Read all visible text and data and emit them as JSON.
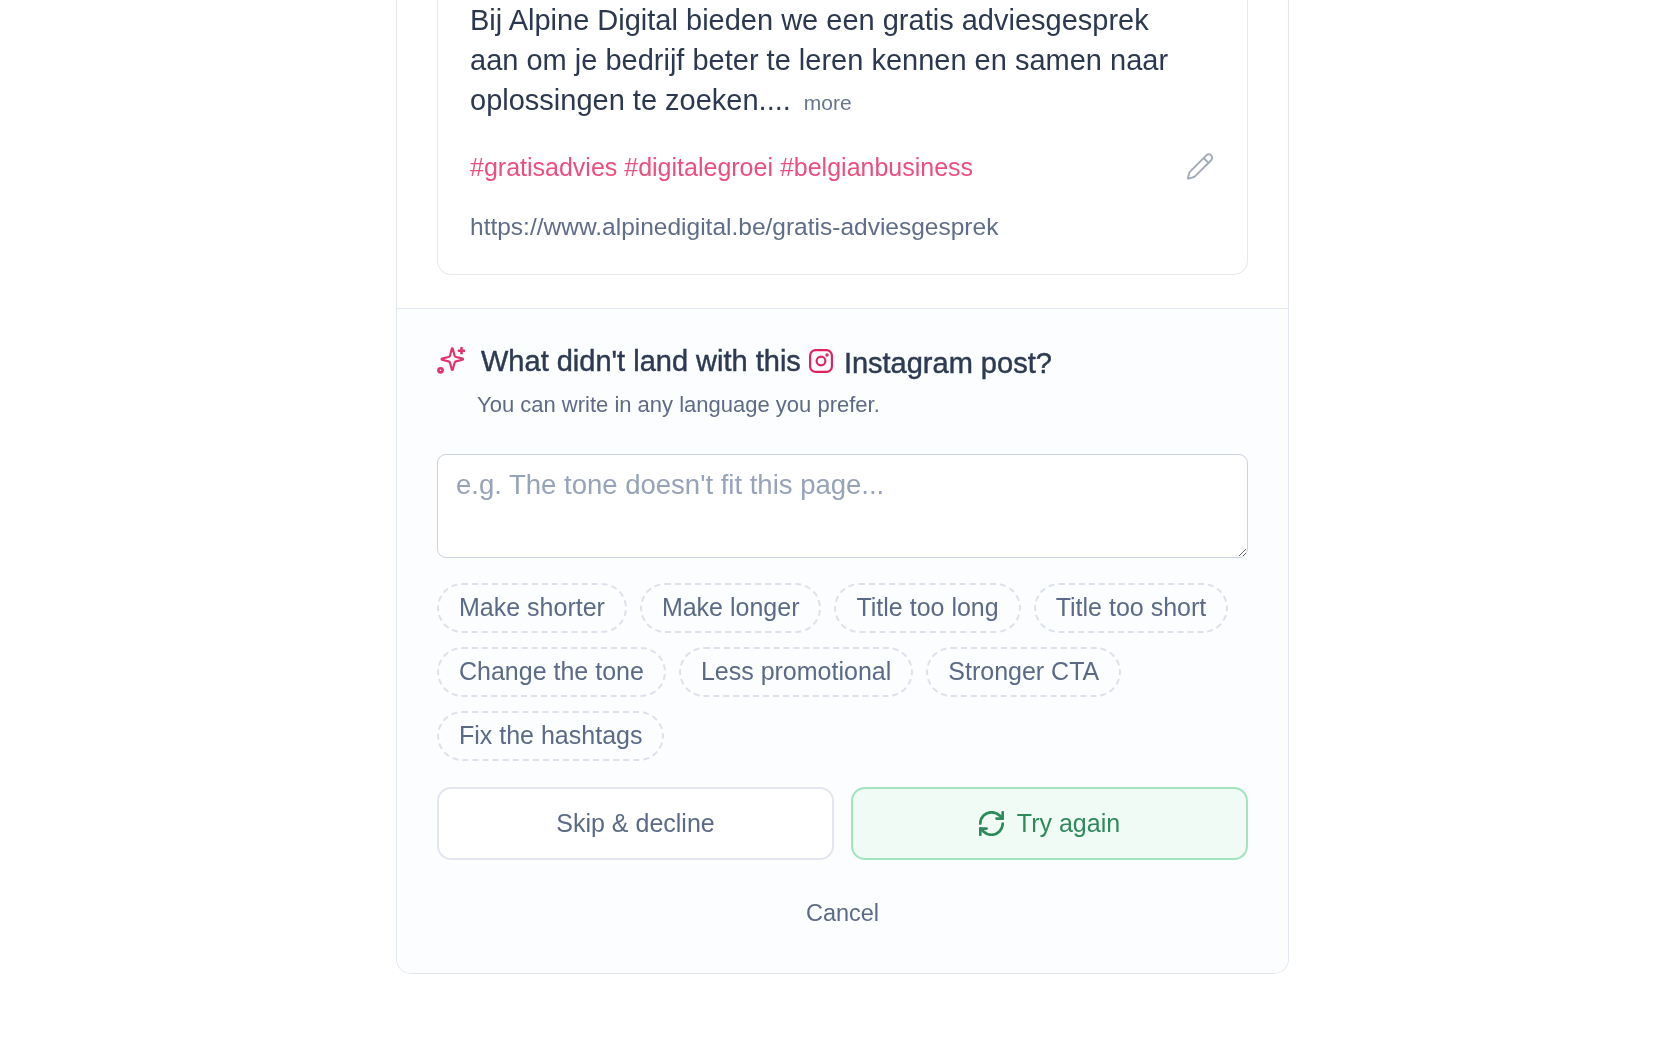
{
  "post_preview": {
    "caption": "Bij Alpine Digital bieden we een gratis adviesgesprek aan om je bedrijf beter te leren kennen en samen naar oplossingen te zoeken....",
    "more_link": "more",
    "hashtags": "#gratisadvies #digitalegroei #belgianbusiness",
    "url": "https://www.alpinedigital.be/gratis-adviesgesprek"
  },
  "feedback": {
    "title_start": "What didn't land with this",
    "title_end": "Instagram post?",
    "subtitle": "You can write in any language you prefer.",
    "input": {
      "placeholder": "e.g. The tone doesn't fit this page..."
    },
    "suggestions": [
      "Make shorter",
      "Make longer",
      "Title too long",
      "Title too short",
      "Change the tone",
      "Less promotional",
      "Stronger CTA",
      "Fix the hashtags"
    ],
    "buttons": [
      {
        "label": "Skip & decline",
        "kind": "secondary"
      },
      {
        "label": "Try again",
        "kind": "primary"
      }
    ],
    "cancel": "Cancel"
  }
}
